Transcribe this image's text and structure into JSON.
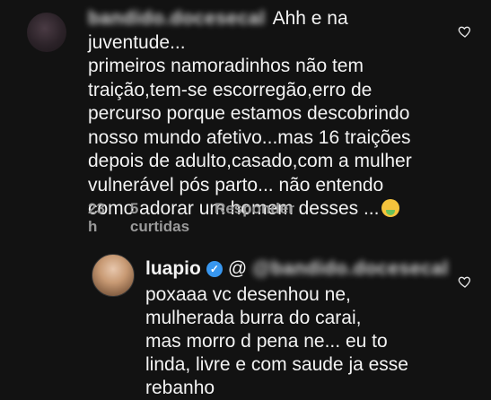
{
  "comment1": {
    "username_hidden": "bandido.docesecal",
    "text_lines": [
      "Ahh e na juventude...",
      "primeiros namoradinhos não tem",
      "traição,tem-se escorregão,erro de",
      "percurso porque estamos descobrindo",
      "nosso mundo afetivo...mas 16 traições",
      "depois de adulto,casado,com a mulher",
      "vulnerável pós parto... não entendo",
      "como adorar um homem desses ..."
    ],
    "emoji": "nauseated-face-emoji",
    "time": "23 h",
    "likes": "5 curtidas",
    "reply": "Responder"
  },
  "comment2": {
    "username": "luapio",
    "mention_hidden": "@bandido.docesecal",
    "mention_prefix": "@",
    "text": "poxaaa vc desenhou ne,\nmulherada burra do carai,\nmas morro d pena ne... eu to\nlinda, livre e com saude ja esse\nrebanho"
  },
  "colors": {
    "background": "#121212",
    "text": "#f2f2f2",
    "meta": "#9a9a9a",
    "verified": "#3897f0"
  }
}
